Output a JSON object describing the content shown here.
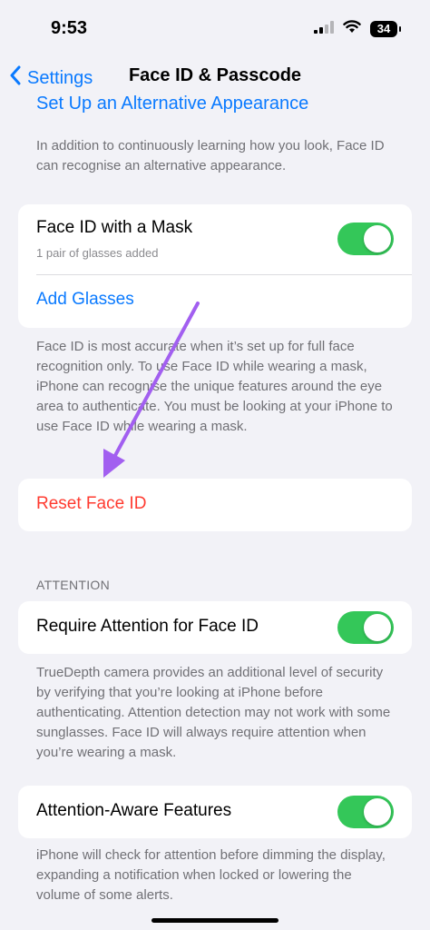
{
  "status_bar": {
    "time": "9:53",
    "battery": "34"
  },
  "nav": {
    "back_label": "Settings",
    "title": "Face ID & Passcode"
  },
  "alt_appearance": {
    "link_label": "Set Up an Alternative Appearance",
    "footnote": "In addition to continuously learning how you look, Face ID can recognise an alternative appearance."
  },
  "mask": {
    "title": "Face ID with a Mask",
    "subtitle": "1 pair of glasses added",
    "toggle_on": true,
    "add_glasses_label": "Add Glasses",
    "footnote": "Face ID is most accurate when it’s set up for full face recognition only. To use Face ID while wearing a mask, iPhone can recognise the unique features around the eye area to authenticate. You must be looking at your iPhone to use Face ID while wearing a mask."
  },
  "reset": {
    "label": "Reset Face ID"
  },
  "attention": {
    "section_header": "ATTENTION",
    "require_title": "Require Attention for Face ID",
    "require_toggle_on": true,
    "require_footnote": "TrueDepth camera provides an additional level of security by verifying that you’re looking at iPhone before authenticating. Attention detection may not work with some sunglasses. Face ID will always require attention when you’re wearing a mask.",
    "aware_title": "Attention-Aware Features",
    "aware_toggle_on": true,
    "aware_footnote": "iPhone will check for attention before dimming the display, expanding a notification when locked or lowering the volume of some alerts."
  },
  "colors": {
    "accent": "#0a7aff",
    "destructive": "#ff3b30",
    "toggle_on": "#34c759",
    "annotation_arrow": "#a25ff0"
  }
}
